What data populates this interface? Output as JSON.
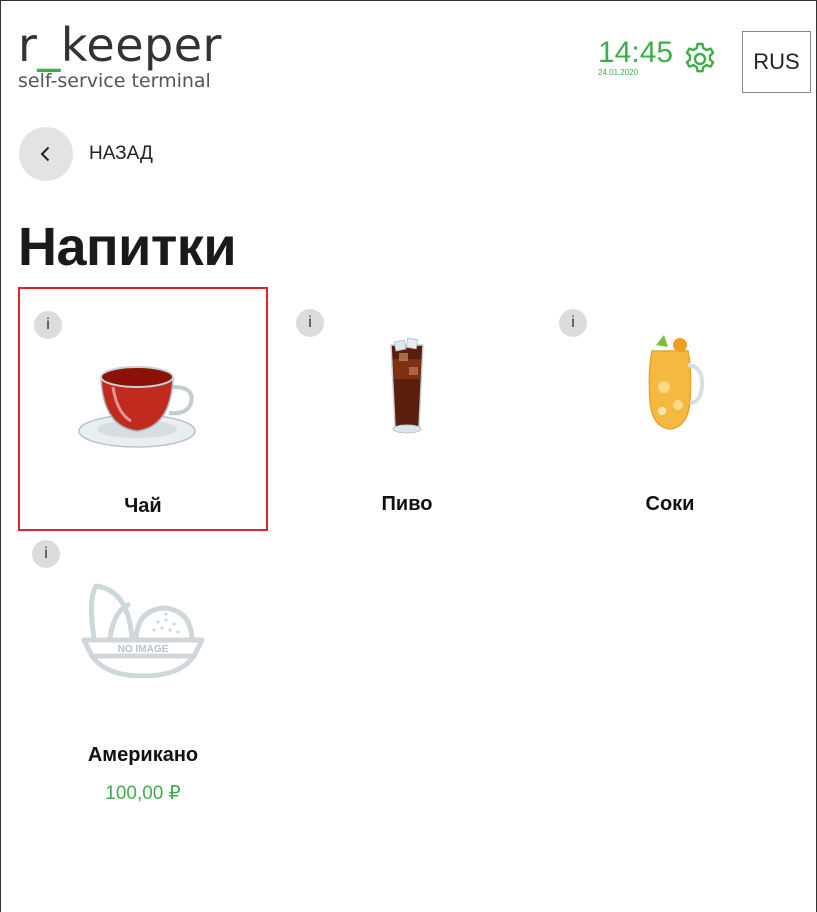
{
  "header": {
    "logo_main_left": "r",
    "logo_main_underscore": "_",
    "logo_main_right": "keeper",
    "logo_sub": "self-service terminal",
    "time": "14:45",
    "date": "24.01.2020",
    "language": "RUS"
  },
  "nav": {
    "back_label": "НАЗАД"
  },
  "page": {
    "title": "Напитки"
  },
  "products": [
    {
      "name": "Чай",
      "price": "",
      "info": "i",
      "image": "tea-cup-icon",
      "selected": true
    },
    {
      "name": "Пиво",
      "price": "",
      "info": "i",
      "image": "cola-glass-icon",
      "selected": false
    },
    {
      "name": "Соки",
      "price": "",
      "info": "i",
      "image": "juice-jug-icon",
      "selected": false
    },
    {
      "name": "Американо",
      "price": "100,00 ₽",
      "info": "i",
      "image": "no-image-icon",
      "image_text": "NO IMAGE",
      "selected": false
    }
  ],
  "colors": {
    "accent": "#3fae49",
    "selection": "#d9262a",
    "info_bg": "#dcdcdc"
  }
}
